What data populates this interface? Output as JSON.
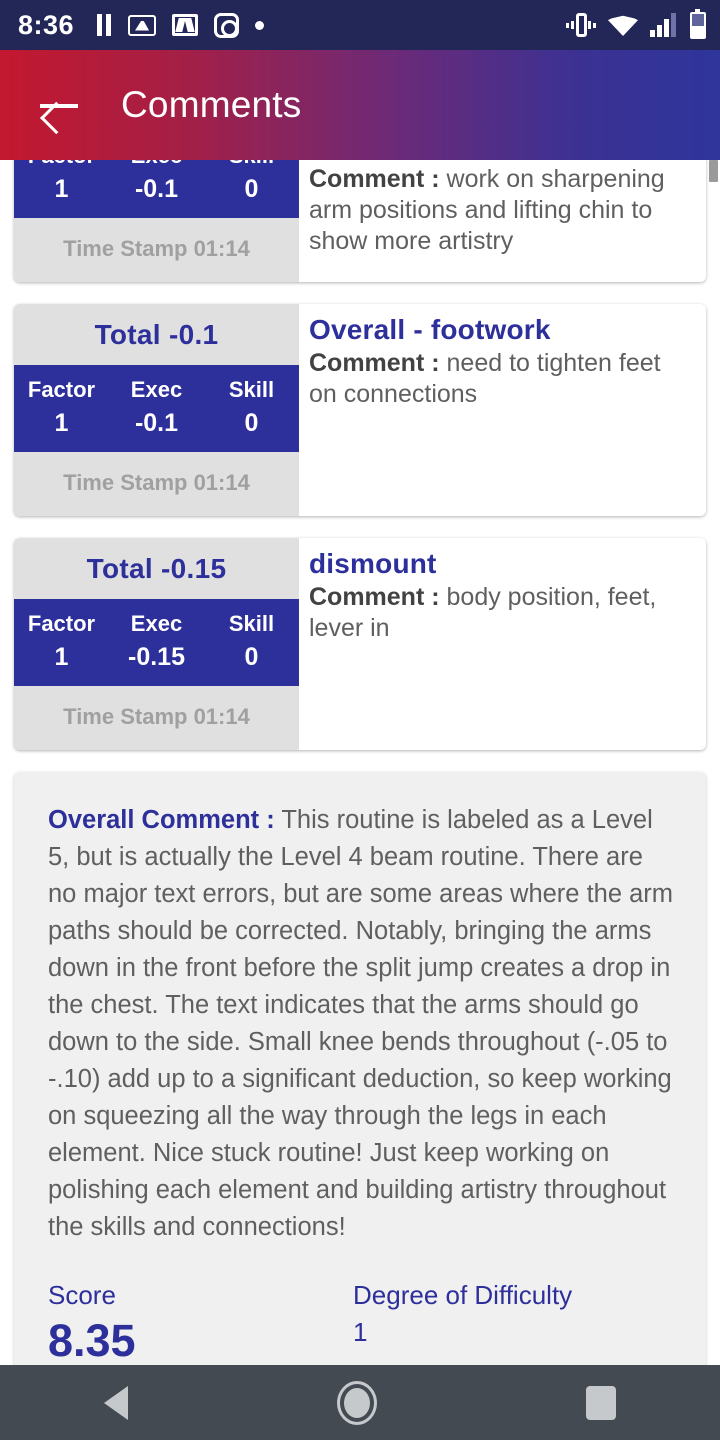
{
  "status_bar": {
    "time": "8:36",
    "left_icons": [
      "pause-icon",
      "mlb-icon",
      "gmail-icon",
      "instagram-icon",
      "dot-icon"
    ],
    "right_icons": [
      "vibrate-icon",
      "wifi-icon",
      "cell-signal-icon",
      "battery-icon"
    ],
    "background_color": "#232758"
  },
  "app_bar": {
    "back_label": "back-arrow-icon",
    "title": "Comments",
    "gradient_from": "#c3182f",
    "gradient_to": "#2e359b"
  },
  "theme": {
    "accent_indigo": "#2d2f9b",
    "panel_gray": "#e0e0e0",
    "overall_bg": "#f0f0f0",
    "body_text": "#5f5f5f"
  },
  "deductions": [
    {
      "partial": true,
      "total_label": "",
      "columns": [
        "Factor",
        "Exec",
        "Skill"
      ],
      "values": [
        "1",
        "-0.1",
        "0"
      ],
      "time_stamp": "Time Stamp 01:14",
      "title": "",
      "comment_label": "Comment :",
      "comment": "work on sharpening arm positions and lifting chin to show more artistry"
    },
    {
      "partial": false,
      "total_label": "Total  -0.1",
      "columns": [
        "Factor",
        "Exec",
        "Skill"
      ],
      "values": [
        "1",
        "-0.1",
        "0"
      ],
      "time_stamp": "Time Stamp 01:14",
      "title": "Overall - footwork",
      "comment_label": "Comment :",
      "comment": "need to tighten feet on connections"
    },
    {
      "partial": false,
      "total_label": "Total  -0.15",
      "columns": [
        "Factor",
        "Exec",
        "Skill"
      ],
      "values": [
        "1",
        "-0.15",
        "0"
      ],
      "time_stamp": "Time Stamp 01:14",
      "title": "dismount",
      "comment_label": "Comment :",
      "comment": "body position, feet, lever in"
    }
  ],
  "overall": {
    "label": "Overall Comment :",
    "text": "This routine is labeled as a Level 5, but is actually the Level 4 beam routine. There are no major text errors, but are some areas where the arm paths should be corrected. Notably, bringing the arms down in the front before the split jump creates a drop in the chest. The text indicates that the arms should go down to the side. Small knee bends throughout (-.05 to -.10) add up to a significant deduction, so keep working on squeezing all the way through the legs in each element. Nice stuck routine! Just keep working on polishing each element and building artistry throughout the skills and connections!",
    "score_label": "Score",
    "score_value": "8.35",
    "dod_label": "Degree of Difficulty",
    "dod_value": "1"
  },
  "nav_bar": {
    "items": [
      "back-triangle-icon",
      "home-circle-icon",
      "recents-square-icon"
    ],
    "background_color": "#434a51"
  }
}
